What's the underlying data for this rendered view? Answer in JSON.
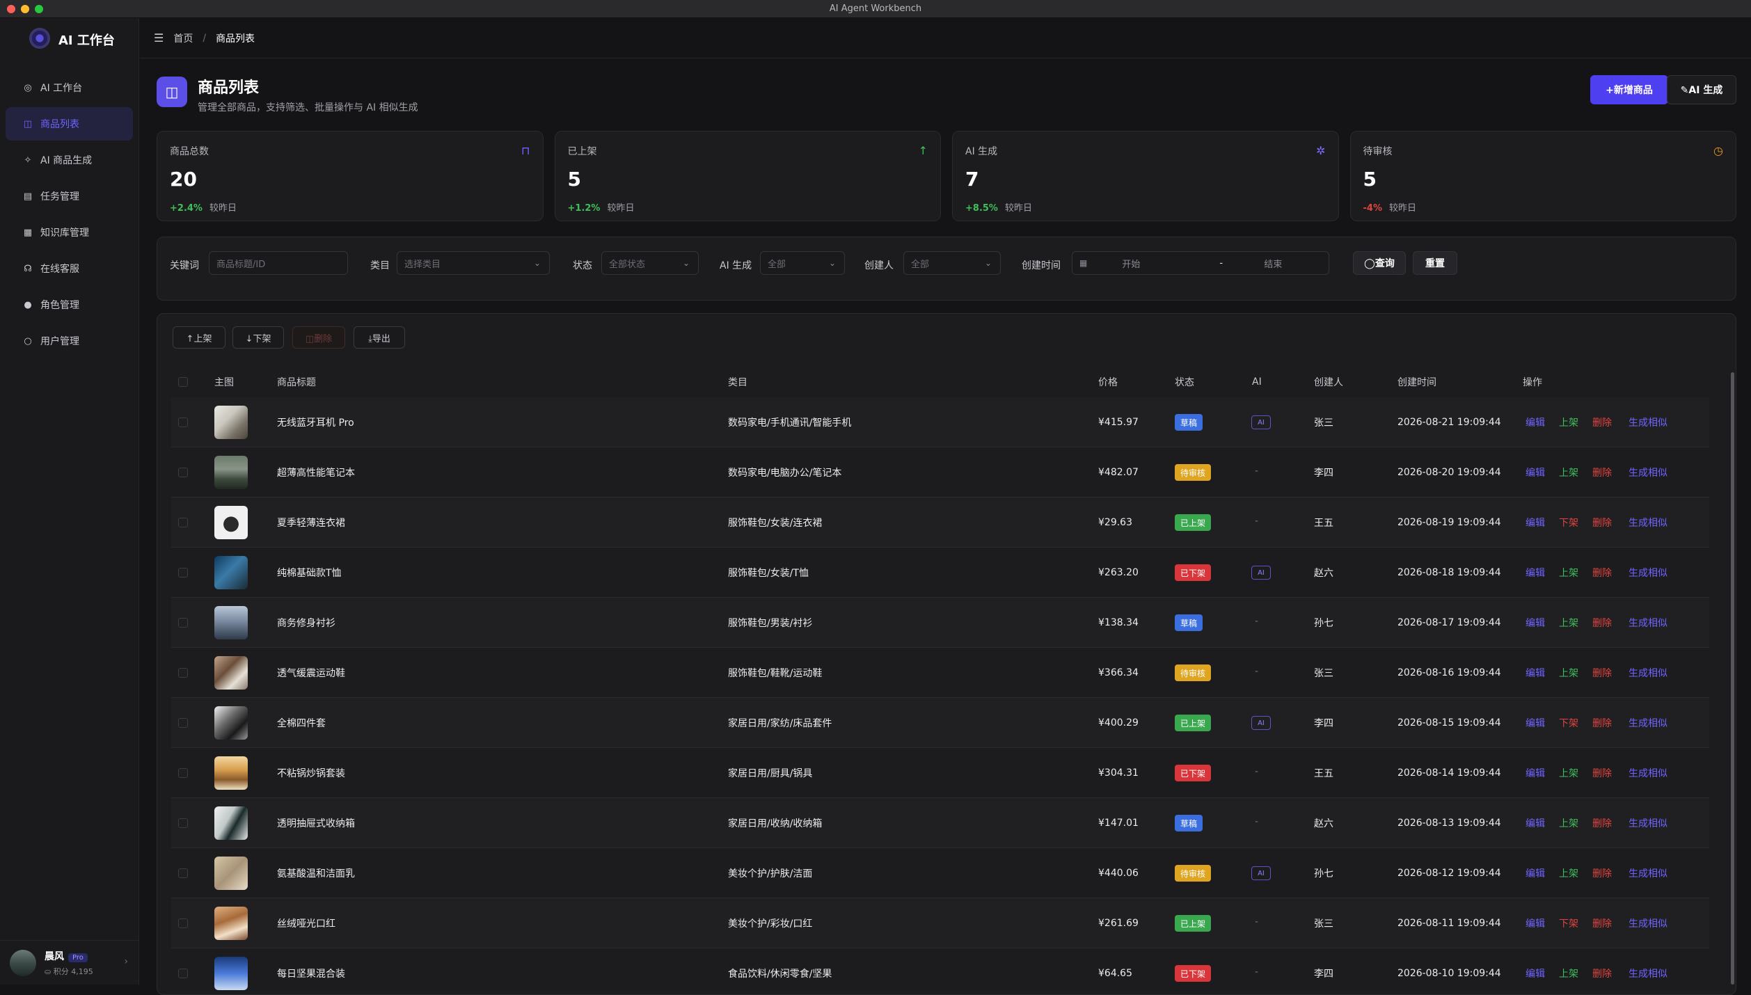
{
  "window": {
    "title": "AI Agent Workbench"
  },
  "sidebar": {
    "brand": "AI 工作台",
    "items": [
      {
        "label": "AI 工作台",
        "icon": "dashboard-icon",
        "glyph": "◎",
        "active": false
      },
      {
        "label": "商品列表",
        "icon": "shopping-bag-icon",
        "glyph": "◫",
        "active": true
      },
      {
        "label": "AI 商品生成",
        "icon": "sparkle-icon",
        "glyph": "✧",
        "active": false
      },
      {
        "label": "任务管理",
        "icon": "clipboard-icon",
        "glyph": "▤",
        "active": false
      },
      {
        "label": "知识库管理",
        "icon": "book-icon",
        "glyph": "▦",
        "active": false
      },
      {
        "label": "在线客服",
        "icon": "headset-icon",
        "glyph": "☊",
        "active": false
      },
      {
        "label": "角色管理",
        "icon": "role-icon",
        "glyph": "●",
        "active": false
      },
      {
        "label": "用户管理",
        "icon": "user-icon",
        "glyph": "○",
        "active": false
      }
    ],
    "user": {
      "name": "晨风",
      "badge": "Pro",
      "points": "⛀ 积分 4,195"
    }
  },
  "breadcrumb": {
    "home": "首页",
    "sep": "/",
    "current": "商品列表"
  },
  "page": {
    "title": "商品列表",
    "subtitle": "管理全部商品，支持筛选、批量操作与 AI 相似生成",
    "new_button": "+新增商品",
    "ai_button": "✎AI 生成"
  },
  "stats": [
    {
      "label": "商品总数",
      "value": "20",
      "delta": "+2.4%",
      "delta_color": "#3fbf5a",
      "foot": "较昨日",
      "icon": "bag-icon",
      "glyph": "⊓",
      "icon_color": "#6f64ff"
    },
    {
      "label": "已上架",
      "value": "5",
      "delta": "+1.2%",
      "delta_color": "#3fbf5a",
      "foot": "较昨日",
      "icon": "arrow-up-icon",
      "glyph": "↑",
      "icon_color": "#3fbf5a"
    },
    {
      "label": "AI 生成",
      "value": "7",
      "delta": "+8.5%",
      "delta_color": "#3fbf5a",
      "foot": "较昨日",
      "icon": "wand-icon",
      "glyph": "✲",
      "icon_color": "#7a6cff"
    },
    {
      "label": "待审核",
      "value": "5",
      "delta": "-4%",
      "delta_color": "#e0443e",
      "foot": "较昨日",
      "icon": "timer-icon",
      "glyph": "◷",
      "icon_color": "#e89a2c"
    }
  ],
  "filters": {
    "keyword_label": "关键词",
    "keyword_placeholder": "商品标题/ID",
    "category_label": "类目",
    "category_placeholder": "选择类目",
    "status_label": "状态",
    "status_value": "全部状态",
    "ai_label": "AI 生成",
    "ai_value": "全部",
    "creator_label": "创建人",
    "creator_value": "全部",
    "date_label": "创建时间",
    "date_start": "开始",
    "date_sep": "-",
    "date_end": "结束",
    "query_button": "◯查询",
    "reset_button": "重置"
  },
  "bulk": {
    "up": "↑上架",
    "down": "↓下架",
    "delete": "◫删除",
    "export": "⤓导出"
  },
  "table": {
    "headers": {
      "image": "主图",
      "title": "商品标题",
      "category": "类目",
      "price": "价格",
      "status": "状态",
      "ai": "AI",
      "creator": "创建人",
      "created": "创建时间",
      "actions": "操作"
    },
    "ai_chip": "AI",
    "dash": "-",
    "ops": {
      "edit": "编辑",
      "up": "上架",
      "down": "下架",
      "delete": "删除",
      "similar": "生成相似"
    },
    "status_colors": {
      "草稿": "#3b6fe0",
      "待审核": "#e0a520",
      "已上架": "#3aa84e",
      "已下架": "#d8363a"
    },
    "rows": [
      {
        "title": "无线蓝牙耳机 Pro",
        "category": "数码家电/手机通讯/智能手机",
        "price": "¥415.97",
        "status": "草稿",
        "ai": true,
        "creator": "张三",
        "created": "2026-08-21 19:09:44",
        "toggle": "上架"
      },
      {
        "title": "超薄高性能笔记本",
        "category": "数码家电/电脑办公/笔记本",
        "price": "¥482.07",
        "status": "待审核",
        "ai": false,
        "creator": "李四",
        "created": "2026-08-20 19:09:44",
        "toggle": "上架"
      },
      {
        "title": "夏季轻薄连衣裙",
        "category": "服饰鞋包/女装/连衣裙",
        "price": "¥29.63",
        "status": "已上架",
        "ai": false,
        "creator": "王五",
        "created": "2026-08-19 19:09:44",
        "toggle": "下架"
      },
      {
        "title": "纯棉基础款T恤",
        "category": "服饰鞋包/女装/T恤",
        "price": "¥263.20",
        "status": "已下架",
        "ai": true,
        "creator": "赵六",
        "created": "2026-08-18 19:09:44",
        "toggle": "上架"
      },
      {
        "title": "商务修身衬衫",
        "category": "服饰鞋包/男装/衬衫",
        "price": "¥138.34",
        "status": "草稿",
        "ai": false,
        "creator": "孙七",
        "created": "2026-08-17 19:09:44",
        "toggle": "上架"
      },
      {
        "title": "透气缓震运动鞋",
        "category": "服饰鞋包/鞋靴/运动鞋",
        "price": "¥366.34",
        "status": "待审核",
        "ai": false,
        "creator": "张三",
        "created": "2026-08-16 19:09:44",
        "toggle": "上架"
      },
      {
        "title": "全棉四件套",
        "category": "家居日用/家纺/床品套件",
        "price": "¥400.29",
        "status": "已上架",
        "ai": true,
        "creator": "李四",
        "created": "2026-08-15 19:09:44",
        "toggle": "下架"
      },
      {
        "title": "不粘锅炒锅套装",
        "category": "家居日用/厨具/锅具",
        "price": "¥304.31",
        "status": "已下架",
        "ai": false,
        "creator": "王五",
        "created": "2026-08-14 19:09:44",
        "toggle": "上架"
      },
      {
        "title": "透明抽屉式收纳箱",
        "category": "家居日用/收纳/收纳箱",
        "price": "¥147.01",
        "status": "草稿",
        "ai": false,
        "creator": "赵六",
        "created": "2026-08-13 19:09:44",
        "toggle": "上架"
      },
      {
        "title": "氨基酸温和洁面乳",
        "category": "美妆个护/护肤/洁面",
        "price": "¥440.06",
        "status": "待审核",
        "ai": true,
        "creator": "孙七",
        "created": "2026-08-12 19:09:44",
        "toggle": "上架"
      },
      {
        "title": "丝绒哑光口红",
        "category": "美妆个护/彩妆/口红",
        "price": "¥261.69",
        "status": "已上架",
        "ai": false,
        "creator": "张三",
        "created": "2026-08-11 19:09:44",
        "toggle": "下架"
      },
      {
        "title": "每日坚果混合装",
        "category": "食品饮料/休闲零食/坚果",
        "price": "¥64.65",
        "status": "已下架",
        "ai": false,
        "creator": "李四",
        "created": "2026-08-10 19:09:44",
        "toggle": "上架"
      }
    ]
  },
  "thumbs": [
    "linear-gradient(135deg,#e8e8e4 0%,#c9c6bd 40%,#7a7468 70%,#4a4538 100%)",
    "linear-gradient(180deg,#6a7a6a 0%,#8a9488 40%,#3e4a3e 70%,#20281f 100%)",
    "radial-gradient(circle at 50% 55%,#2a2a2a 0 30%,#f0f0f0 31%)",
    "linear-gradient(135deg,#0e3a5c 0%,#3a7aa8 45%,#1a2a34 100%)",
    "linear-gradient(180deg,#b9c7d8 0%,#7a8aa0 45%,#2e3a4a 100%)",
    "linear-gradient(135deg,#c4a58a 0%,#6a4e3a 40%,#e6e0d6 70%,#8a7a6a 100%)",
    "linear-gradient(135deg,#f2f2f2 0%,#6a6a6a 40%,#1a1a1a 70%,#9a9a9a 100%)",
    "linear-gradient(180deg,#f3d6a0 0%,#d8a050 40%,#8a5a2a 70%,#f0e0c0 100%)",
    "linear-gradient(120deg,#f0f0f0 0%,#c0c8c8 40%,#1a2a2a 60%,#e8e8e8 100%)",
    "linear-gradient(135deg,#d6c6a8 0%,#a89478 50%,#e8dcc8 100%)",
    "linear-gradient(160deg,#e0b080 0%,#a86a3a 40%,#f2e0c8 70%,#7a4a2a 100%)",
    "linear-gradient(180deg,#1a3a7a 0%,#4a7ad8 50%,#c8daf2 100%)"
  ]
}
